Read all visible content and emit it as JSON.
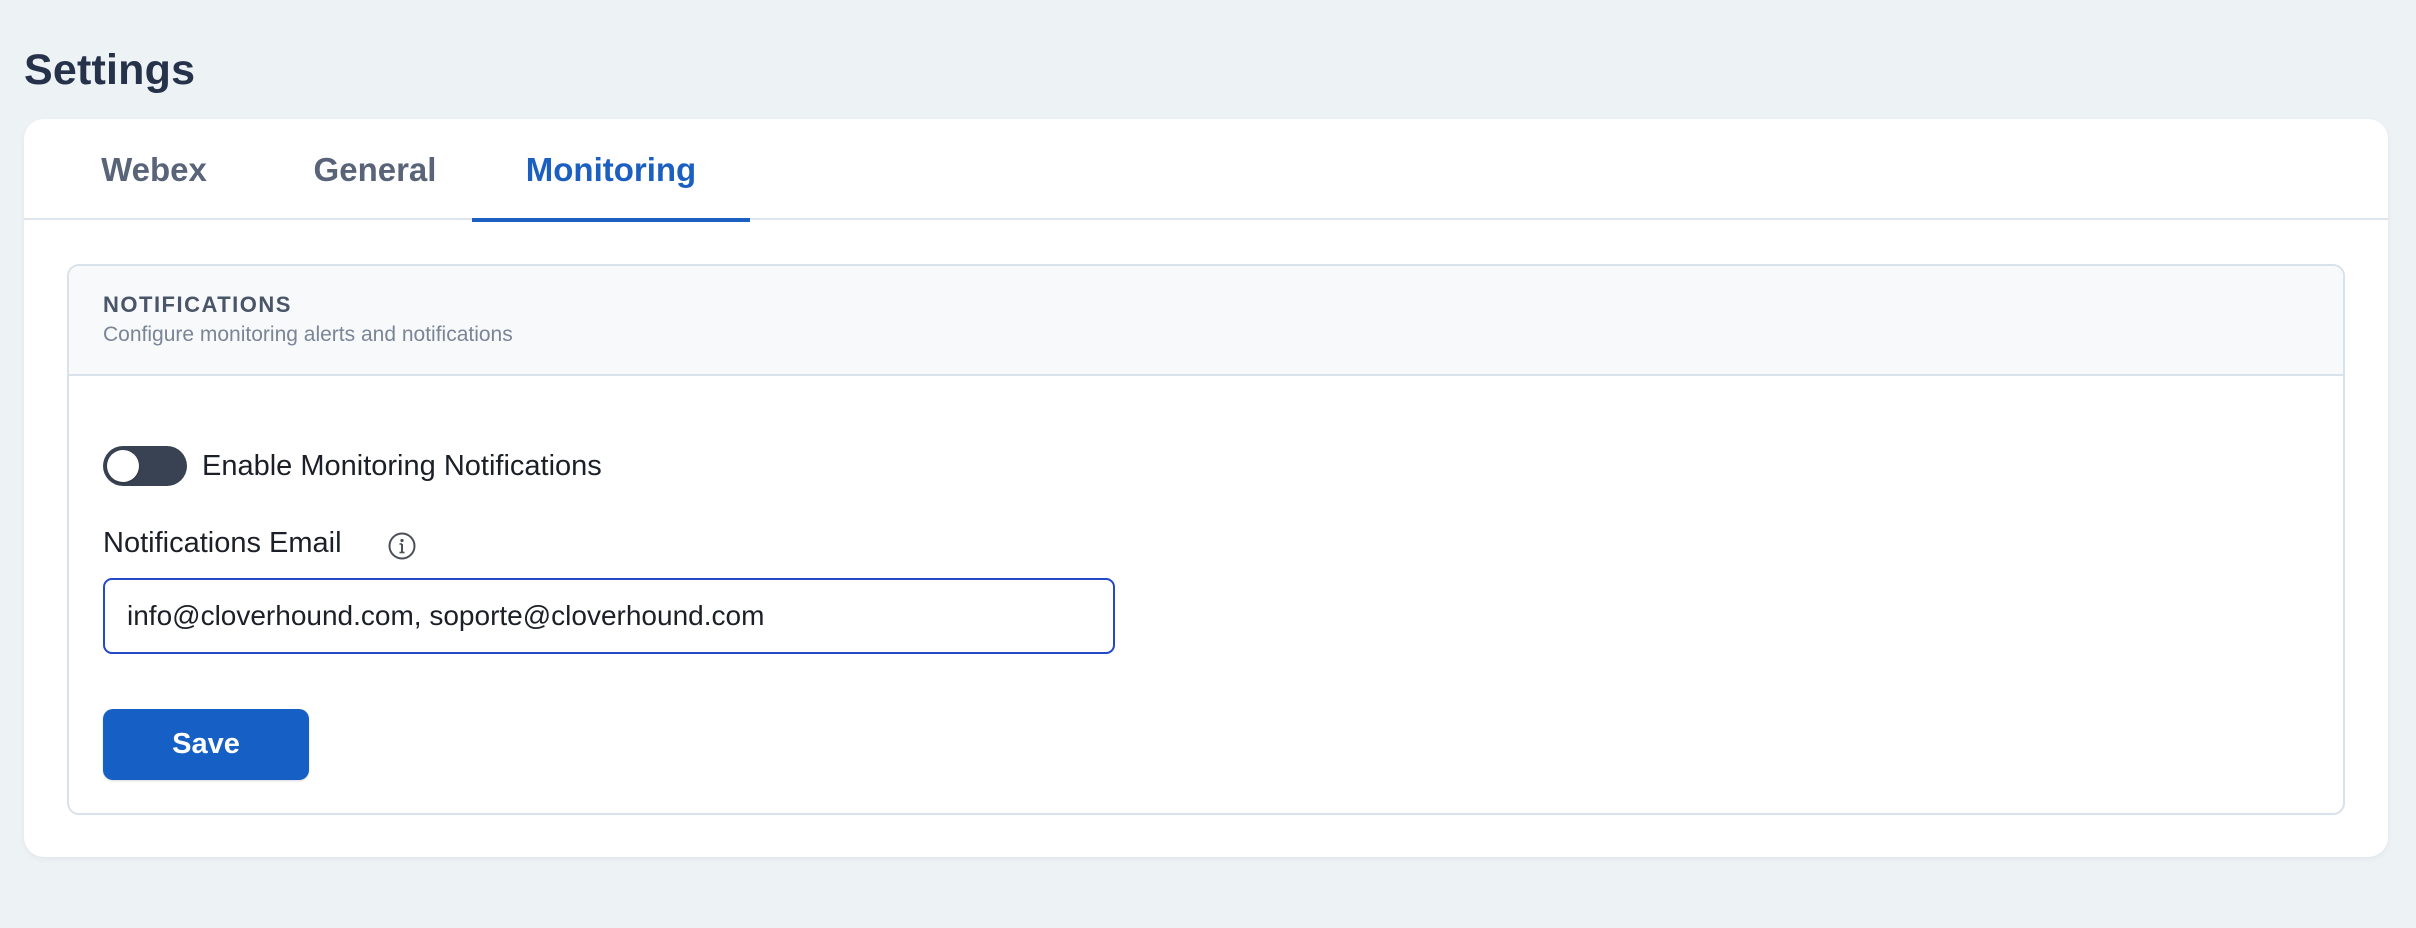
{
  "page": {
    "title": "Settings"
  },
  "tabs": [
    {
      "label": "Webex",
      "active": false
    },
    {
      "label": "General",
      "active": false
    },
    {
      "label": "Monitoring",
      "active": true
    }
  ],
  "notifications": {
    "title": "NOTIFICATIONS",
    "subtitle": "Configure monitoring alerts and notifications",
    "toggle": {
      "label": "Enable Monitoring Notifications",
      "enabled": false
    },
    "email": {
      "label": "Notifications Email",
      "value": "info@cloverhound.com, soporte@cloverhound.com",
      "info_icon": "info-circle-icon"
    },
    "save_label": "Save"
  },
  "colors": {
    "accent": "#1b5fc1",
    "save_button": "#165fc4",
    "toggle_track": "#394253",
    "input_focus_border": "#2448c8",
    "page_background": "#edf2f5"
  }
}
